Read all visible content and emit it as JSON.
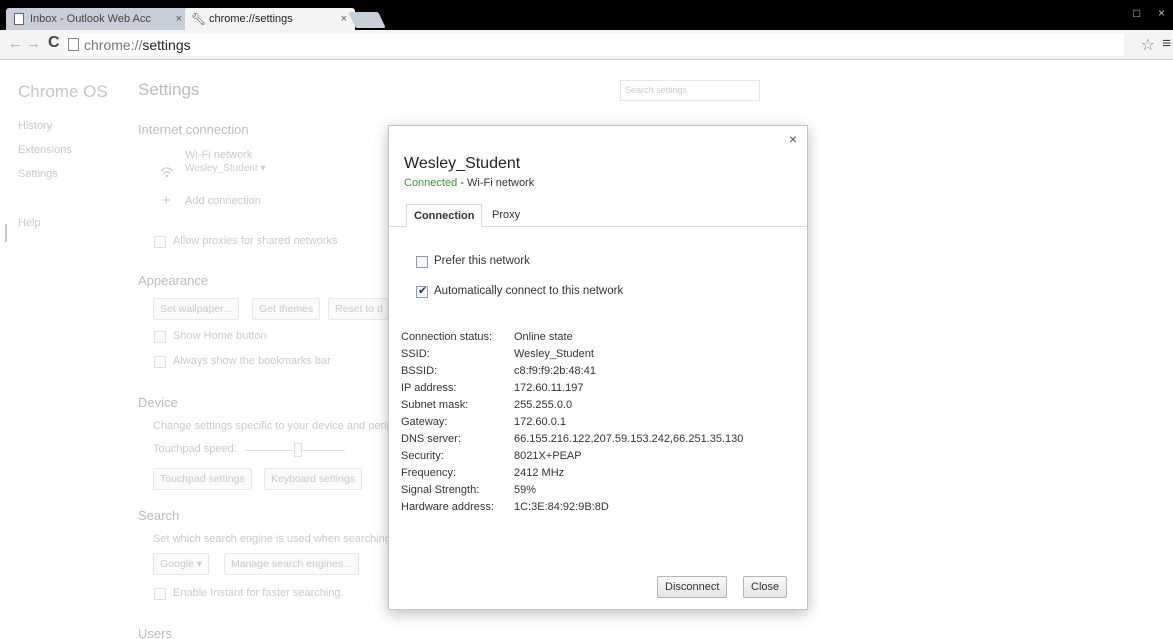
{
  "browser": {
    "tabs": [
      {
        "title": "Inbox - Outlook Web Acc"
      },
      {
        "title": "chrome://settings"
      }
    ],
    "omnibox": {
      "scheme": "chrome://",
      "host": "settings"
    }
  },
  "settings": {
    "brand": "Chrome OS",
    "title": "Settings",
    "search_placeholder": "Search settings",
    "nav": [
      "History",
      "Extensions",
      "Settings",
      "Help"
    ],
    "internet": {
      "title": "Internet connection",
      "wifi_label": "Wi-Fi network",
      "wifi_name": "Wesley_Student",
      "add_connection": "Add connection",
      "allow_proxies": "Allow proxies for shared networks"
    },
    "appearance": {
      "title": "Appearance",
      "set_wallpaper": "Set wallpaper...",
      "get_themes": "Get themes",
      "reset": "Reset to d",
      "show_home": "Show Home button",
      "show_bookmarks": "Always show the bookmarks bar"
    },
    "device": {
      "title": "Device",
      "desc": "Change settings specific to your device and perip",
      "touchpad_speed": "Touchpad speed:",
      "touchpad_settings": "Touchpad settings",
      "keyboard_settings": "Keyboard settings"
    },
    "search": {
      "title": "Search",
      "desc": "Set which search engine is used when searching",
      "engine": "Google",
      "manage": "Manage search engines...",
      "instant": "Enable Instant for faster searching."
    },
    "users": {
      "title": "Users"
    }
  },
  "dialog": {
    "network_name": "Wesley_Student",
    "status_connected": "Connected",
    "status_type": " - Wi-Fi network",
    "tabs": [
      "Connection",
      "Proxy"
    ],
    "prefer_network": {
      "label": "Prefer this network",
      "checked": false
    },
    "auto_connect": {
      "label": "Automatically connect to this network",
      "checked": true
    },
    "details": [
      {
        "key": "Connection status:",
        "value": "Online state"
      },
      {
        "key": "SSID:",
        "value": "Wesley_Student"
      },
      {
        "key": "BSSID:",
        "value": "c8:f9:f9:2b:48:41"
      },
      {
        "key": "IP address:",
        "value": "172.60.11.197"
      },
      {
        "key": "Subnet mask:",
        "value": "255.255.0.0"
      },
      {
        "key": "Gateway:",
        "value": "172.60.0.1"
      },
      {
        "key": "DNS server:",
        "value": "66.155.216.122,207.59.153.242,66.251.35.130"
      },
      {
        "key": "Security:",
        "value": "8021X+PEAP"
      },
      {
        "key": "Frequency:",
        "value": "2412 MHz"
      },
      {
        "key": "Signal Strength:",
        "value": "59%"
      },
      {
        "key": "Hardware address:",
        "value": "1C:3E:84:92:9B:8D"
      }
    ],
    "disconnect_label": "Disconnect",
    "close_label": "Close"
  }
}
